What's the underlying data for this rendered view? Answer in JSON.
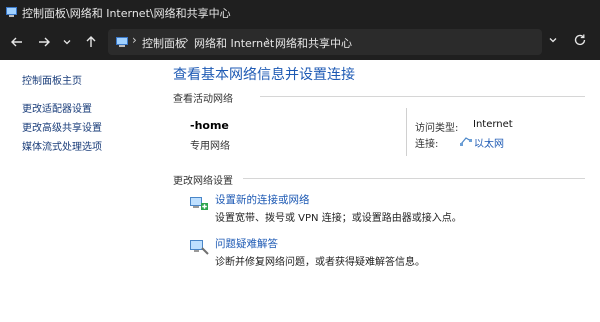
{
  "window": {
    "title": "控制面板\\网络和 Internet\\网络和共享中心"
  },
  "address_bar": {
    "crumbs": [
      "控制面板",
      "网络和 Internet",
      "网络和共享中心"
    ]
  },
  "sidebar": {
    "items": [
      {
        "label": "控制面板主页"
      },
      {
        "label": "更改适配器设置"
      },
      {
        "label": "更改高级共享设置"
      },
      {
        "label": "媒体流式处理选项"
      }
    ]
  },
  "main": {
    "title": "查看基本网络信息并设置连接",
    "active_networks": {
      "section_label": "查看活动网络",
      "network_name": "-home",
      "network_type": "专用网络",
      "access_type_label": "访问类型:",
      "access_type_value": "Internet",
      "connection_label": "连接:",
      "connection_value": "以太网"
    },
    "change_settings": {
      "section_label": "更改网络设置",
      "tasks": [
        {
          "title": "设置新的连接或网络",
          "description": "设置宽带、拨号或 VPN 连接；或设置路由器或接入点。"
        },
        {
          "title": "问题疑难解答",
          "description": "诊断并修复网络问题，或者获得疑难解答信息。"
        }
      ]
    }
  },
  "icons": {
    "back": "arrow-left-icon",
    "forward": "arrow-right-icon",
    "recent": "chevron-down-icon",
    "up": "arrow-up-icon",
    "address_dropdown": "chevron-down-icon",
    "refresh": "refresh-icon"
  },
  "colors": {
    "link": "#1e5ab4",
    "sidebar_link": "#1a3d7a",
    "titlebar_bg": "#1f1f1f"
  }
}
